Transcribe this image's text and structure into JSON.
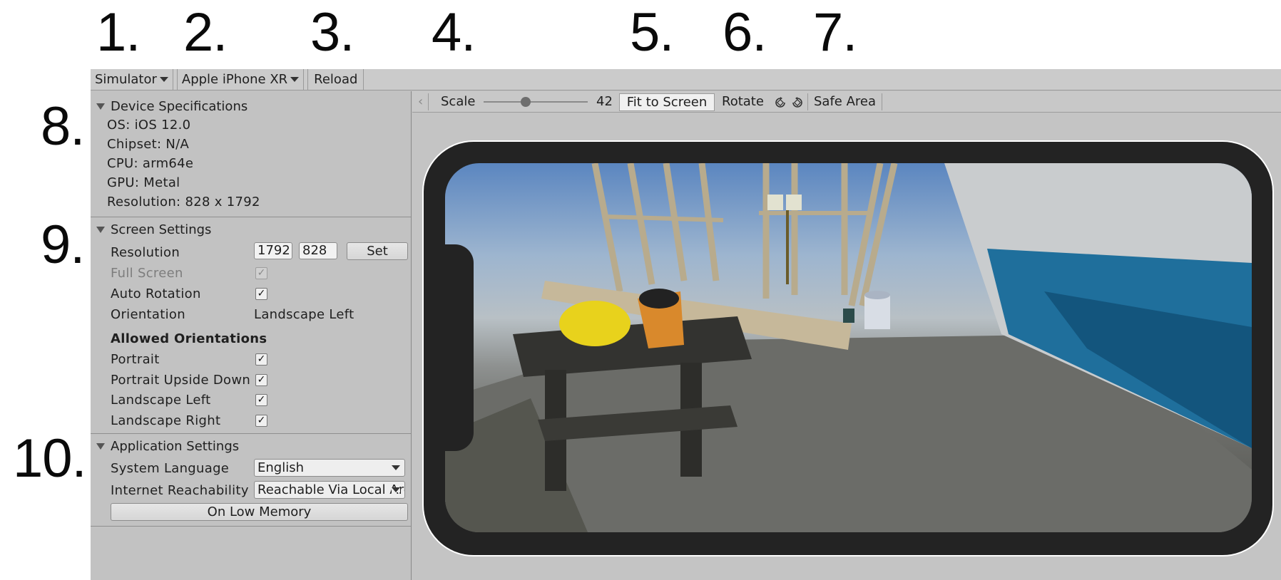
{
  "callouts": [
    "1.",
    "2.",
    "3.",
    "4.",
    "5.",
    "6.",
    "7.",
    "8.",
    "9.",
    "10."
  ],
  "toolbar": {
    "simulator_label": "Simulator",
    "device_label": "Apple iPhone XR",
    "reload_label": "Reload"
  },
  "device_specifications": {
    "header": "Device Specifications",
    "os": "OS: iOS 12.0",
    "chipset": "Chipset: N/A",
    "cpu": "CPU: arm64e",
    "gpu": "GPU: Metal",
    "resolution": "Resolution: 828 x 1792"
  },
  "screen_settings": {
    "header": "Screen Settings",
    "resolution_label": "Resolution",
    "resolution_width": "1792",
    "resolution_height": "828",
    "set_label": "Set",
    "full_screen_label": "Full Screen",
    "full_screen_checked": true,
    "auto_rotation_label": "Auto Rotation",
    "auto_rotation_checked": true,
    "orientation_label": "Orientation",
    "orientation_value": "Landscape Left",
    "allowed_orientations_label": "Allowed Orientations",
    "portrait_label": "Portrait",
    "portrait_upside_down_label": "Portrait Upside Down",
    "landscape_left_label": "Landscape Left",
    "landscape_right_label": "Landscape Right"
  },
  "application_settings": {
    "header": "Application Settings",
    "system_language_label": "System Language",
    "system_language_value": "English",
    "internet_reachability_label": "Internet Reachability",
    "internet_reachability_value": "Reachable Via Local Area Network",
    "low_memory_label": "On Low Memory"
  },
  "viewport_toolbar": {
    "scale_label": "Scale",
    "scale_value": "42",
    "fit_to_screen_label": "Fit to Screen",
    "rotate_label": "Rotate",
    "safe_area_label": "Safe Area"
  },
  "check_glyph": "✓",
  "colors": {
    "editor_bg": "#c2c2c2",
    "device_bezel": "#232323"
  }
}
